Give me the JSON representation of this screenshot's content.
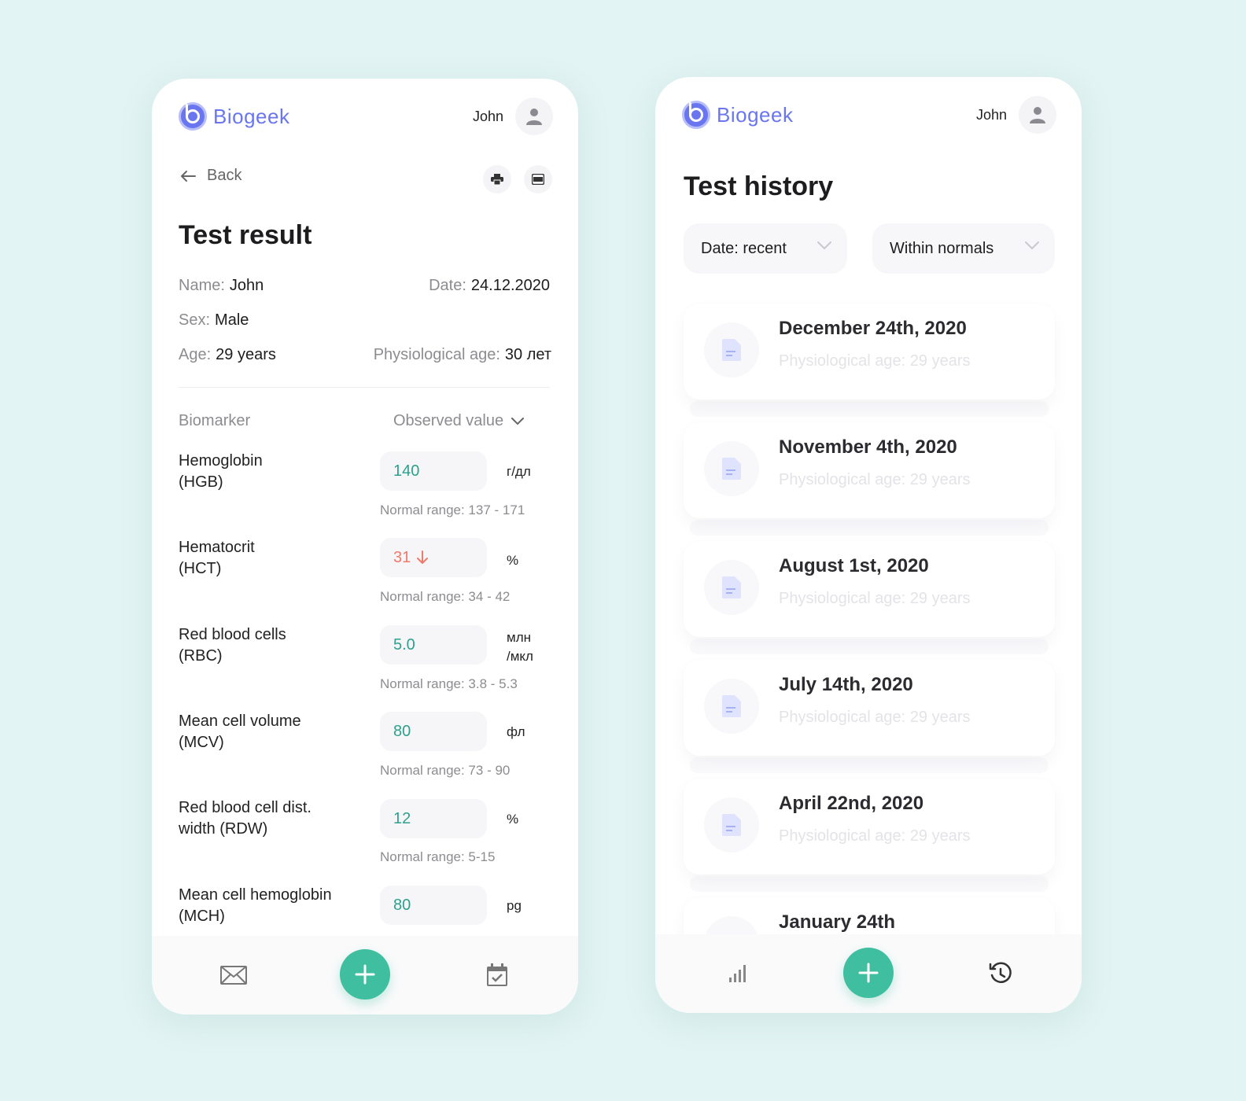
{
  "brand": {
    "name": "Biogeek",
    "color": "#6a76f0"
  },
  "user": {
    "name": "John"
  },
  "colors": {
    "accent": "#3fbf9f",
    "normal_value": "#2ea08d",
    "low_value": "#f07a6a"
  },
  "result_screen": {
    "back_label": "Back",
    "title": "Test result",
    "info": {
      "name_label": "Name:",
      "name_value": "John",
      "date_label": "Date:",
      "date_value": "24.12.2020",
      "sex_label": "Sex:",
      "sex_value": "Male",
      "age_label": "Age:",
      "age_value": "29 years",
      "phys_label": "Physiological age:",
      "phys_value": "30 лет"
    },
    "columns": {
      "biomarker": "Biomarker",
      "observed": "Observed value"
    },
    "markers": [
      {
        "name_line1": "Hemoglobin",
        "name_line2": "(HGB)",
        "value": "140",
        "unit_line1": "г/дл",
        "unit_line2": "",
        "range": "Normal range: 137 - 171",
        "status": "normal"
      },
      {
        "name_line1": "Hematocrit",
        "name_line2": "(HCT)",
        "value": "31",
        "unit_line1": "%",
        "unit_line2": "",
        "range": "Normal range: 34 - 42",
        "status": "low"
      },
      {
        "name_line1": "Red blood cells",
        "name_line2": "(RBC)",
        "value": "5.0",
        "unit_line1": "млн",
        "unit_line2": "/мкл",
        "range": "Normal range: 3.8 - 5.3",
        "status": "normal"
      },
      {
        "name_line1": "Mean cell volume",
        "name_line2": "(MCV)",
        "value": "80",
        "unit_line1": "фл",
        "unit_line2": "",
        "range": "Normal range: 73 - 90",
        "status": "normal"
      },
      {
        "name_line1": "Red blood cell dist.",
        "name_line2": "width  (RDW)",
        "value": "12",
        "unit_line1": "%",
        "unit_line2": "",
        "range": "Normal range: 5-15",
        "status": "normal"
      },
      {
        "name_line1": "Mean cell hemoglobin",
        "name_line2": "(MCH)",
        "value": "80",
        "unit_line1": "pg",
        "unit_line2": "",
        "range": "",
        "status": "normal"
      }
    ],
    "nav": {
      "left_icon": "mail-icon",
      "center_icon": "plus-icon",
      "right_icon": "calendar-check-icon"
    }
  },
  "history_screen": {
    "title": "Test history",
    "filters": {
      "date": "Date: recent",
      "status": "Within normals"
    },
    "entries": [
      {
        "date": "December 24th, 2020",
        "sub": "Physiological age: 29 years"
      },
      {
        "date": "November 4th, 2020",
        "sub": "Physiological age:  29 years"
      },
      {
        "date": "August 1st, 2020",
        "sub": "Physiological age:  29 years"
      },
      {
        "date": "July 14th, 2020",
        "sub": "Physiological age:  29 years"
      },
      {
        "date": "April 22nd, 2020",
        "sub": "Physiological age:  29 years"
      },
      {
        "date": "January 24th",
        "sub": ""
      }
    ],
    "nav": {
      "left_icon": "bar-chart-icon",
      "center_icon": "plus-icon",
      "right_icon": "history-icon"
    }
  }
}
